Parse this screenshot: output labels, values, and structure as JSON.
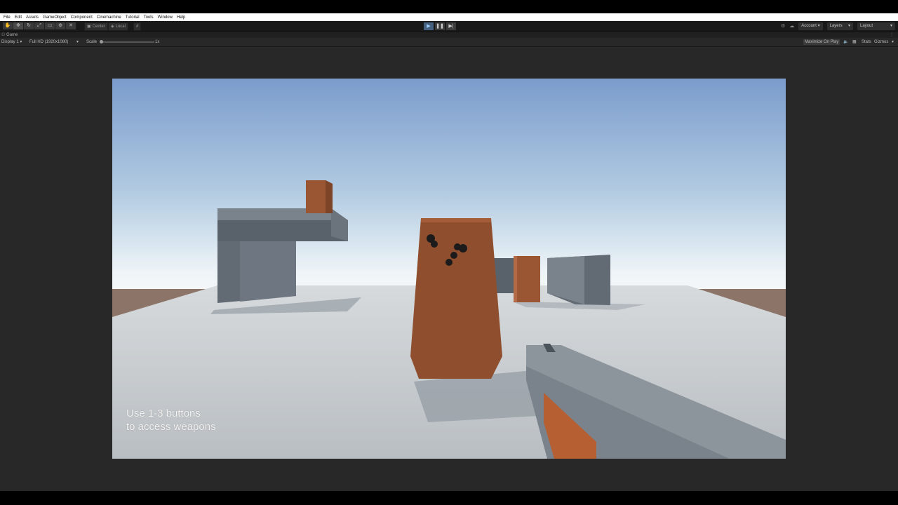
{
  "menu": [
    "File",
    "Edit",
    "Assets",
    "GameObject",
    "Component",
    "Cinemachine",
    "Tutorial",
    "Tools",
    "Window",
    "Help"
  ],
  "toolbar": {
    "pivot_center": "Center",
    "pivot_local": "Local",
    "account": "Account",
    "layers": "Layers",
    "layout": "Layout"
  },
  "tab": {
    "game": "Game"
  },
  "gamebar": {
    "display": "Display 1",
    "resolution": "Full HD (1920x1080)",
    "scale_label": "Scale",
    "scale_value": "1x",
    "maximize": "Maximize On Play",
    "stats": "Stats",
    "gizmos": "Gizmos"
  },
  "game": {
    "hint_line1": "Use 1-3 buttons",
    "hint_line2": "to access weapons"
  },
  "colors": {
    "sky_top": "#7b9ccc",
    "horizon": "#e9f1f6",
    "ground": "#c6cbcf",
    "box_orange": "#9a5532",
    "box_gray": "#626b74",
    "editor_bg": "#282828"
  }
}
